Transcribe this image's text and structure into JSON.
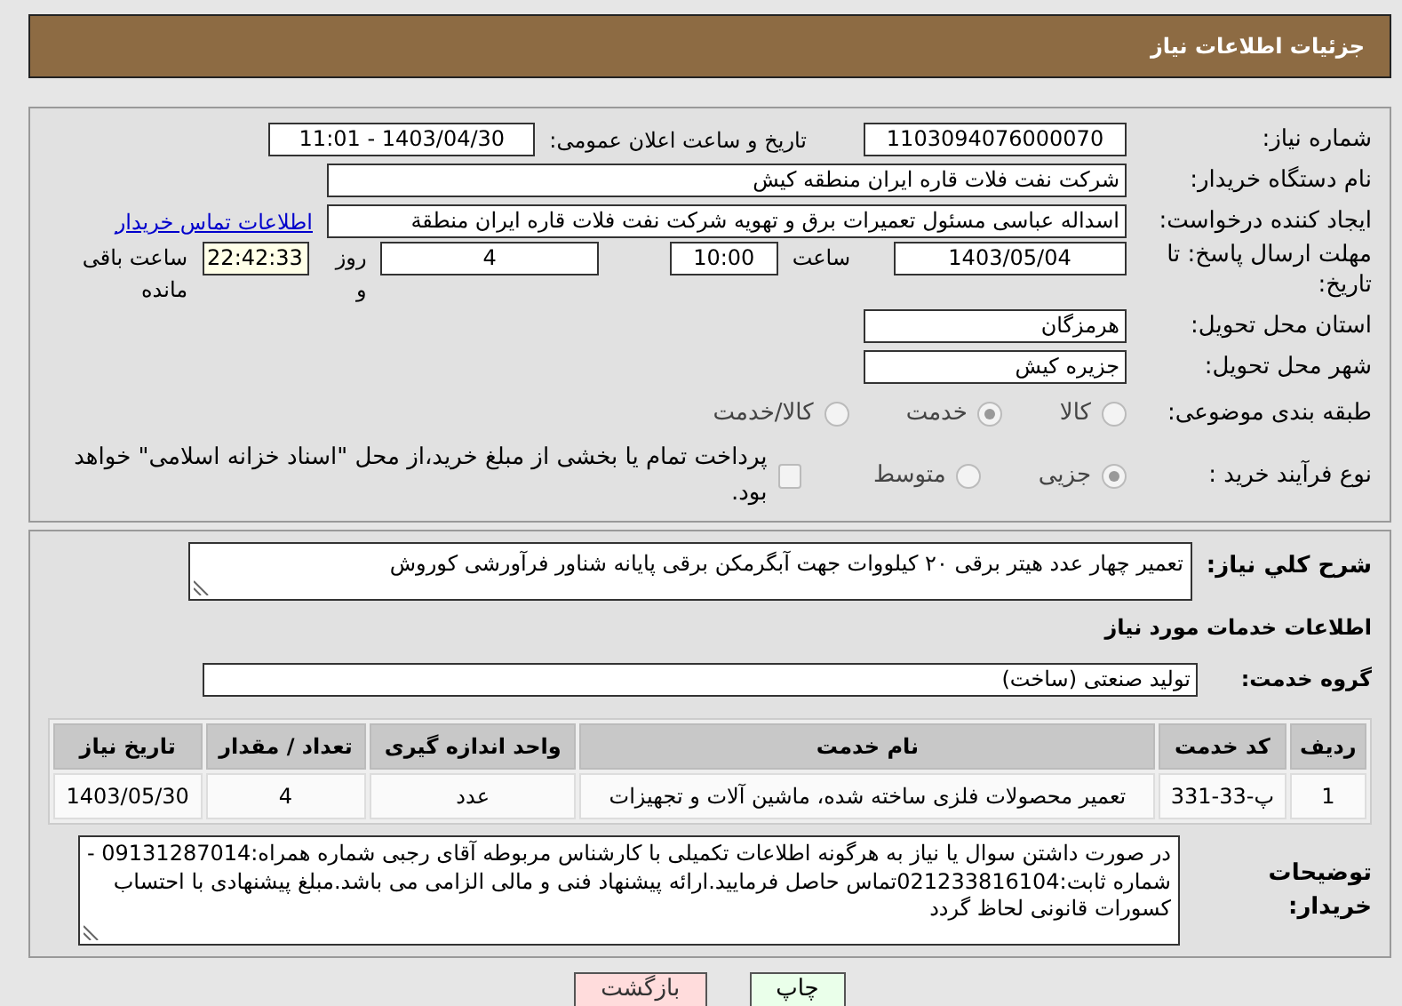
{
  "header": {
    "title": "جزئیات اطلاعات نیاز"
  },
  "need_number": {
    "label": "شماره نیاز:",
    "value": "1103094076000070"
  },
  "announce": {
    "label": "تاریخ و ساعت اعلان عمومی:",
    "value": "1403/04/30 - 11:01"
  },
  "buyer": {
    "label": "نام دستگاه خریدار:",
    "value": "شرکت نفت فلات قاره ایران منطقه کیش"
  },
  "creator": {
    "label": "ایجاد کننده درخواست:",
    "value": "اسداله  عباسی  مسئول تعمیرات برق و تهویه  شرکت نفت فلات قاره ایران منطقة",
    "link": "اطلاعات تماس خریدار"
  },
  "deadline": {
    "label": "مهلت ارسال پاسخ: تا تاریخ:",
    "date": "1403/05/04",
    "time_label": "ساعت",
    "time": "10:00",
    "days": "4",
    "days_label": "روز و",
    "remaining": "22:42:33",
    "remaining_label": "ساعت باقی مانده"
  },
  "province": {
    "label": "استان محل تحویل:",
    "value": "هرمزگان"
  },
  "city": {
    "label": "شهر محل تحویل:",
    "value": "جزیره کیش"
  },
  "category": {
    "label": "طبقه بندی موضوعی:",
    "options": [
      {
        "label": "کالا",
        "selected": false
      },
      {
        "label": "خدمت",
        "selected": true
      },
      {
        "label": "کالا/خدمت",
        "selected": false
      }
    ]
  },
  "process": {
    "label": "نوع فرآیند خرید :",
    "options": [
      {
        "label": "جزیی",
        "selected": true
      },
      {
        "label": "متوسط",
        "selected": false
      }
    ],
    "treasury": {
      "label": "پرداخت تمام یا بخشی از مبلغ خرید،از محل \"اسناد خزانه اسلامی\" خواهد بود.",
      "checked": false
    }
  },
  "description": {
    "label": "شرح کلي نیاز:",
    "value": "تعمیر چهار عدد هیتر برقی ۲۰ کیلووات جهت آبگرمکن برقی پایانه شناور فرآورشی کوروش"
  },
  "services_title": "اطلاعات خدمات مورد نیاز",
  "service_group": {
    "label": "گروه خدمت:",
    "value": "تولید صنعتی (ساخت)"
  },
  "table": {
    "columns": [
      "ردیف",
      "کد خدمت",
      "نام خدمت",
      "واحد اندازه گیری",
      "تعداد / مقدار",
      "تاریخ نیاز"
    ],
    "rows": [
      [
        "1",
        "پ-33-331",
        "تعمیر محصولات فلزی ساخته شده، ماشین آلات و تجهیزات",
        "عدد",
        "4",
        "1403/05/30"
      ]
    ]
  },
  "buyer_notes": {
    "label": "توضیحات خریدار:",
    "value": "در صورت داشتن سوال یا نیاز به هرگونه اطلاعات تکمیلی با کارشناس مربوطه آقای رجبی شماره همراه:09131287014 - شماره ثابت:021233816104تماس حاصل فرمایید.ارائه پیشنهاد فنی و مالی الزامی می باشد.مبلغ  پیشنهادی با احتساب کسورات قانونی لحاظ گردد"
  },
  "buttons": [
    {
      "label": "چاپ",
      "kind": "print"
    },
    {
      "label": "بازگشت",
      "kind": "back"
    }
  ]
}
